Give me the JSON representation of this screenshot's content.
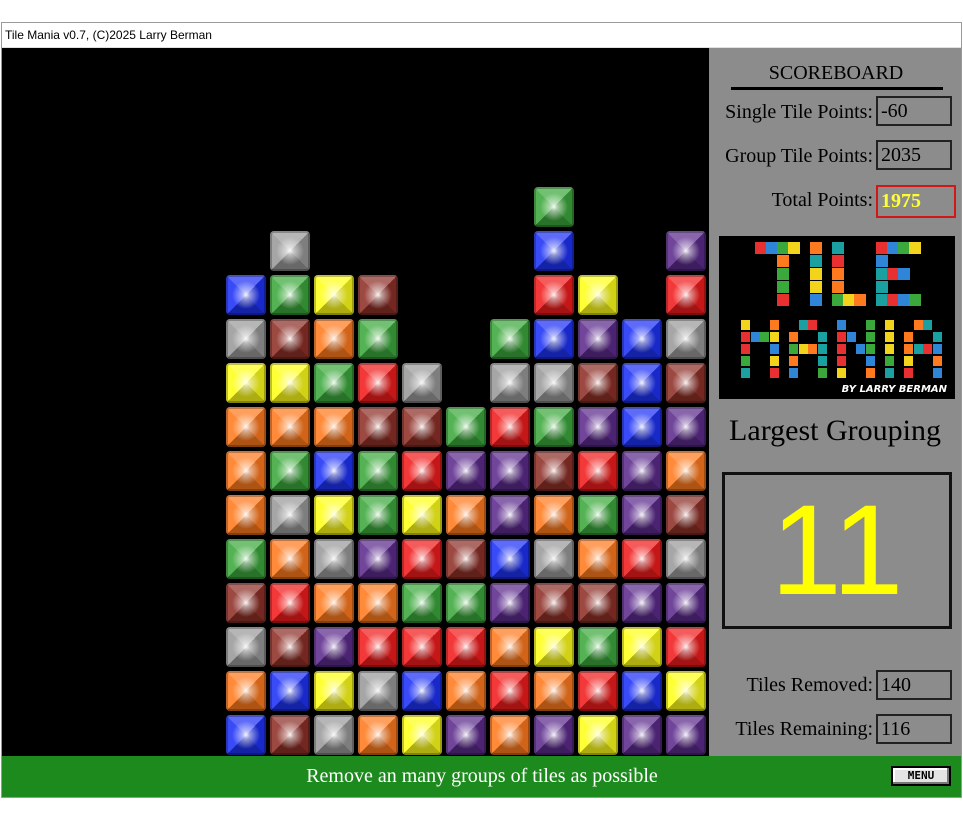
{
  "window": {
    "title": "Tile Mania  v0.7, (C)2025 Larry Berman"
  },
  "scoreboard": {
    "title": "SCOREBOARD",
    "single_label": "Single Tile Points:",
    "single_value": "-60",
    "group_label": "Group Tile Points:",
    "group_value": "2035",
    "total_label": "Total Points:",
    "total_value": "1975",
    "largest_label": "Largest Grouping",
    "largest_value": "11",
    "removed_label": "Tiles Removed:",
    "removed_value": "140",
    "remaining_label": "Tiles Remaining:",
    "remaining_value": "116"
  },
  "logo": {
    "text": "TILE MANIA",
    "byline": "BY LARRY BERMAN"
  },
  "status": {
    "message": "Remove an many groups of tiles as possible",
    "menu_label": "MENU"
  },
  "colors": {
    "O": "#ff7a1e",
    "R": "#f01c1c",
    "B": "#1e32f5",
    "G": "#3ca83c",
    "Y": "#ffff1a",
    "P": "#5c2b8c",
    "M": "#8e3028",
    "S": "#9a9a9a"
  },
  "board": {
    "columns": [
      [
        "B",
        "O",
        "S",
        "M",
        "G",
        "O",
        "O",
        "O",
        "Y",
        "S",
        "B"
      ],
      [
        "M",
        "B",
        "M",
        "R",
        "O",
        "S",
        "G",
        "O",
        "Y",
        "M",
        "G",
        "S"
      ],
      [
        "S",
        "Y",
        "P",
        "O",
        "S",
        "Y",
        "B",
        "O",
        "G",
        "O",
        "Y"
      ],
      [
        "O",
        "S",
        "R",
        "O",
        "P",
        "G",
        "G",
        "M",
        "R",
        "G",
        "M"
      ],
      [
        "Y",
        "B",
        "R",
        "G",
        "R",
        "Y",
        "R",
        "M",
        "S"
      ],
      [
        "P",
        "O",
        "R",
        "G",
        "M",
        "O",
        "P",
        "G"
      ],
      [
        "O",
        "R",
        "O",
        "P",
        "B",
        "P",
        "P",
        "R",
        "S",
        "G"
      ],
      [
        "P",
        "O",
        "Y",
        "M",
        "S",
        "O",
        "M",
        "G",
        "S",
        "B",
        "R",
        "B",
        "G"
      ],
      [
        "Y",
        "R",
        "G",
        "M",
        "O",
        "G",
        "R",
        "P",
        "M",
        "P",
        "Y"
      ],
      [
        "P",
        "B",
        "Y",
        "P",
        "R",
        "P",
        "P",
        "B",
        "B",
        "B"
      ],
      [
        "P",
        "Y",
        "R",
        "P",
        "S",
        "M",
        "O",
        "P",
        "M",
        "S",
        "R",
        "P"
      ]
    ]
  }
}
